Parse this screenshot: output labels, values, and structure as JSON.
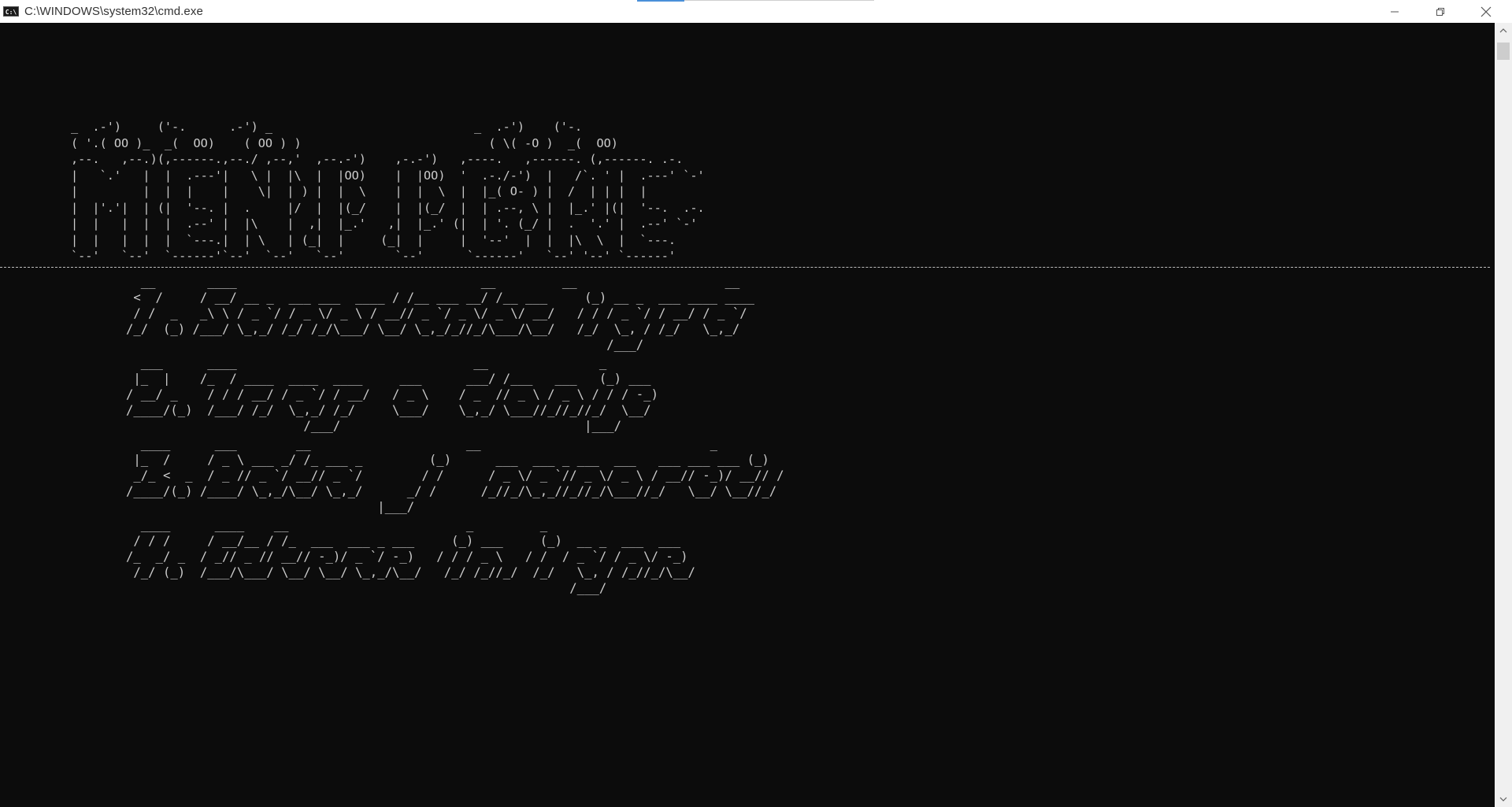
{
  "window": {
    "title": "C:\\WINDOWS\\system32\\cmd.exe",
    "icon_label": "C:\\",
    "controls": [
      "minimize-icon",
      "restore-icon",
      "close-icon"
    ]
  },
  "console": {
    "banner_ascii": "_  .-')     ('-.      .-') _                            _  .-')    ('-.\n( '.( OO )_  _(  OO)    ( OO ) )                          ( \\( -O )  _(  OO)\n,--.   ,--.)(,------.,--./ ,--,'  ,--.-')    ,-.-')   ,----.   ,------. (,------. .-.\n|   `.'   |  |  .---'|   \\ |  |\\  |  |OO)    |  |OO)  '  .-./-')  |   /`. ' |  .---' `-'\n|         |  |  |    |    \\|  | ) |  |  \\    |  |  \\  |  |_( O- ) |  /  | | |  |\n|  |'.'|  | (|  '--. |  .     |/  |  |(_/    |  |(_/  |  | .--, \\ |  |_.' |(|  '--.  .-.\n|  |   |  |  |  .--' |  |\\    |  ,|  |_.'   ,|  |_.' (|  | '. (_/ |  .  '.' |  .--' `-'\n|  |   |  |  |  `---.|  | \\   | (_|  |     (_|  |     |  '--'  |  |  |\\  \\  |  `---.\n`--'   `--'  `------'`--'  `--'   `--'       `--'      `------'   `--' '--' `------'",
    "separator": "-------------------------------------------------------------------------------------------------------------------------------------------------------------------------------------",
    "options": [
      {
        "label": "1. Transfer to fare",
        "ascii": "  __       ____                                 __         __                    __\n <  /     / __/ __ _  ___ ___  ____ / /__ ___ __/ /__ ___     (_) __ _  ___ ____ ____\n / /  _   _\\ \\ / _ `/ / _ \\/ _ \\ / __// _ `/ _ \\/ _ \\/ __/   / / / _ `/ / __/ / _ `/\n/_/  (_) /___/ \\_,_/ /_/ /_/\\___/ \\__/ \\_,_/_//_/\\___/\\__/   /_/  \\_, / /_/   \\_,_/\n                                                                 /___/"
      },
      {
        "label": "2. Trip to Dojo",
        "ascii": "  ___      ____                                __               _\n |_  |    /_  / ____  ____  ____     ___      ___/ /___   ___   (_) ___\n/ __/ _    / / / __/ / _ `/ / __/   / _ \\    / _  // _ \\ / _ \\ / / / -_)\n/____/(_)  /___/ /_/  \\_,_/ /_/     \\___/    \\_,_/ \\___//_//_//_/  \\__/\n                        /___/                                 |___/"
      },
      {
        "label": "3. Battle in random zone",
        "ascii": "  ____      ___        __                     __                               _\n |_  /     / _ \\ ___ _/ /_ ___ _         (_)      ___  ___ _ ___  ___   ___ ___ ___ (_)\n _/_ <  _  / _ // _ `/ __// _ `/        / /      / _ \\/ _ `// _ \\/ _ \\ / __// -_)/ __// /\n/____/(_) /____/ \\_,_/\\__/ \\_,_/      _/ /      /_//_/\\_,_//_//_/\\___//_/   \\__/ \\__//_/\n                                  |___/"
      },
      {
        "label": "4. Close the game",
        "ascii": "  ____      ____    __                        _         _\n / / /     / __/__ / /_  ___  ___ _ ___     (_) ___     (_)  __ _  ___  ___\n/_  _/ _  / _// _ // __// -_)/ _ `/ -_)   / / / _ \\   / /  / _ `/ / _ \\/ -_)\n /_/ (_)  /___/\\___/ \\__/ \\__/ \\_,_/\\__/   /_/ /_//_/  /_/   \\_, / /_//_/\\__/\n                                                            /___/"
      }
    ]
  }
}
